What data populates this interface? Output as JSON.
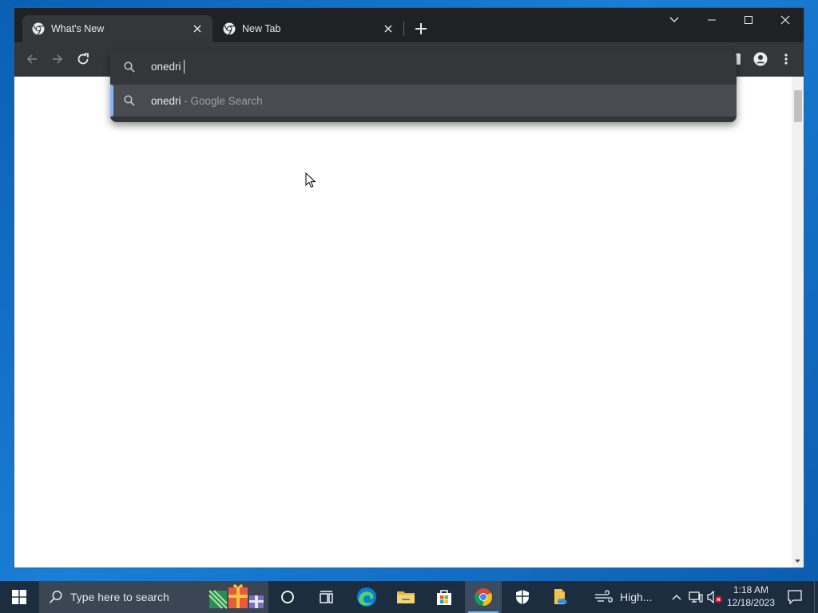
{
  "browser": {
    "tabs": [
      {
        "title": "What's New",
        "active": true
      },
      {
        "title": "New Tab",
        "active": false
      }
    ],
    "omnibox": {
      "typed_text": "onedri",
      "suggestions": [
        {
          "query": "onedri",
          "suffix": " - Google Search"
        }
      ]
    }
  },
  "taskbar": {
    "search_placeholder": "Type here to search",
    "weather": "High...",
    "clock_time": "1:18 AM",
    "clock_date": "12/18/2023",
    "pinned": [
      "cortana-icon",
      "task-view-icon",
      "edge-icon",
      "file-explorer-icon",
      "microsoft-store-icon",
      "chrome-icon",
      "windows-security-icon",
      "onedrive-file-icon"
    ]
  },
  "colors": {
    "chrome_dark": "#202124",
    "toolbar": "#35363a",
    "suggestion_highlight": "#494b50",
    "focus_accent": "#8ab4f8",
    "taskbar": "#1c2d3f"
  }
}
